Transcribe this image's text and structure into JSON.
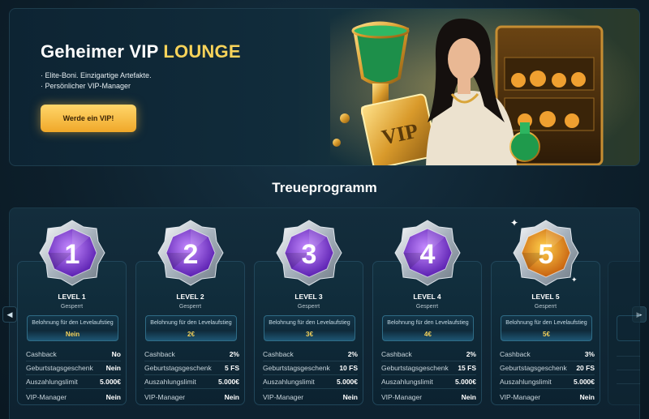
{
  "hero": {
    "title_main": "Geheimer VIP",
    "title_accent": "LOUNGE",
    "bullets": [
      "· Elite-Boni. Einzigartige Artefakte.",
      "· Persönlicher VIP-Manager"
    ],
    "cta_label": "Werde ein VIP!",
    "art_label": "VIP"
  },
  "section_title": "Treueprogramm",
  "labels": {
    "reward": "Belohnung für den Levelaufstieg",
    "cashback": "Cashback",
    "birthday": "Geburtstagsgeschenk",
    "withdrawal": "Auszahlungslimit",
    "manager": "VIP-Manager"
  },
  "levels": [
    {
      "number": "1",
      "name": "LEVEL 1",
      "status": "Gesperrt",
      "reward": "Nein",
      "cashback": "No",
      "birthday": "Nein",
      "withdrawal": "5.000€",
      "manager": "Nein"
    },
    {
      "number": "2",
      "name": "LEVEL 2",
      "status": "Gesperrt",
      "reward": "2€",
      "cashback": "2%",
      "birthday": "5 FS",
      "withdrawal": "5.000€",
      "manager": "Nein"
    },
    {
      "number": "3",
      "name": "LEVEL 3",
      "status": "Gesperrt",
      "reward": "3€",
      "cashback": "2%",
      "birthday": "10 FS",
      "withdrawal": "5.000€",
      "manager": "Nein"
    },
    {
      "number": "4",
      "name": "LEVEL 4",
      "status": "Gesperrt",
      "reward": "4€",
      "cashback": "2%",
      "birthday": "15 FS",
      "withdrawal": "5.000€",
      "manager": "Nein"
    },
    {
      "number": "5",
      "name": "LEVEL 5",
      "status": "Gesperrt",
      "reward": "5€",
      "cashback": "3%",
      "birthday": "20 FS",
      "withdrawal": "5.000€",
      "manager": "Nein"
    }
  ],
  "nav": {
    "prev_icon": "chevron-left-icon",
    "next_icon": "chevron-right-icon"
  },
  "colors": {
    "accent_gold": "#f7d35a",
    "badge_purple": "#8a3fe0",
    "badge_orange": "#e9891e",
    "background": "#0f2230"
  }
}
